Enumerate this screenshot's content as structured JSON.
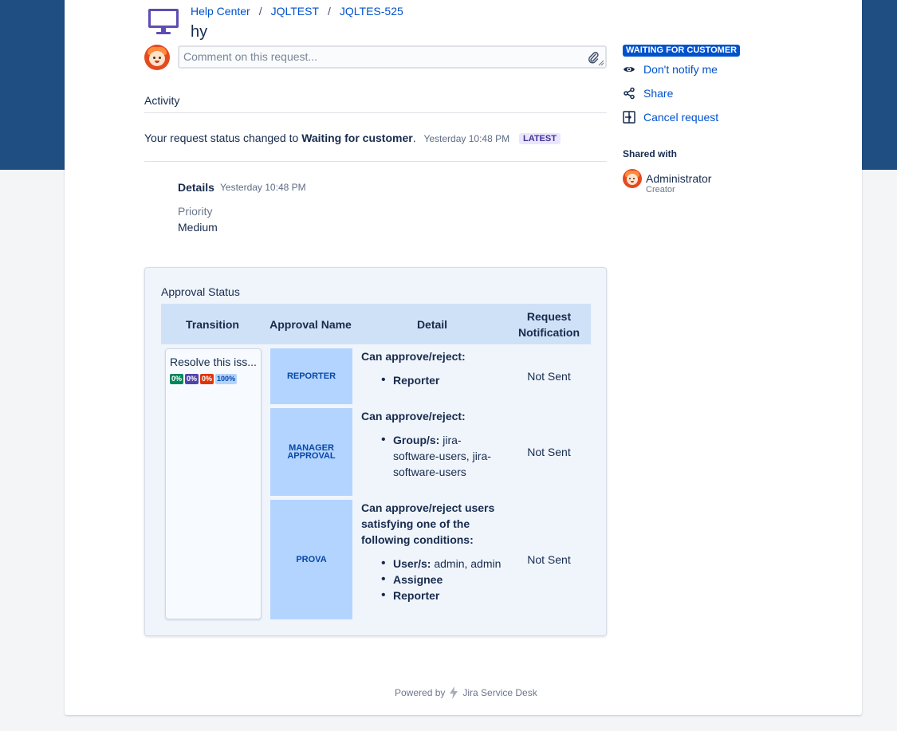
{
  "breadcrumb": [
    "Help Center",
    "JQLTEST",
    "JQLTES-525"
  ],
  "request": {
    "title": "hy"
  },
  "comment": {
    "placeholder": "Comment on this request..."
  },
  "activity": {
    "heading": "Activity",
    "status_prefix": "Your request status changed to",
    "status_value": "Waiting for customer",
    "status_suffix": ".",
    "status_time": "Yesterday 10:48 PM",
    "latest_badge": "LATEST",
    "details_label": "Details",
    "details_time": "Yesterday 10:48 PM",
    "priority_label": "Priority",
    "priority_value": "Medium"
  },
  "approval": {
    "title": "Approval Status",
    "columns": [
      "Transition",
      "Approval Name",
      "Detail",
      "Request Notification"
    ],
    "transition": {
      "name": "Resolve this iss...",
      "percentages": [
        "0%",
        "0%",
        "0%",
        "100%"
      ]
    },
    "rows": [
      {
        "name": "REPORTER",
        "detail_heading": "Can approve/reject:",
        "items": [
          {
            "label": "Reporter",
            "value": ""
          }
        ],
        "notification": "Not Sent"
      },
      {
        "name": "MANAGER APPROVAL",
        "detail_heading": "Can approve/reject:",
        "items": [
          {
            "label": "Group/s:",
            "value": "jira-software-users, jira-software-users"
          }
        ],
        "notification": "Not Sent"
      },
      {
        "name": "PROVA",
        "detail_heading": "Can approve/reject users satisfying one of the following conditions:",
        "items": [
          {
            "label": "User/s:",
            "value": "admin, admin"
          },
          {
            "label": "Assignee",
            "value": ""
          },
          {
            "label": "Reporter",
            "value": ""
          }
        ],
        "notification": "Not Sent"
      }
    ]
  },
  "footer": {
    "powered_by": "Powered by",
    "product": "Jira Service Desk"
  },
  "sidebar": {
    "status": "WAITING FOR CUSTOMER",
    "actions": [
      "Don't notify me",
      "Share",
      "Cancel request"
    ],
    "shared_with_label": "Shared with",
    "shared_user": {
      "name": "Administrator",
      "role": "Creator"
    }
  },
  "colors": {
    "banner": "#1f4e82",
    "link": "#0052cc",
    "status_lozenge": "#0052cc",
    "approval_block": "#b3d4ff",
    "latest_badge_bg": "#eae6ff"
  },
  "icons": [
    "monitor-icon",
    "paperclip-icon",
    "eye-icon",
    "share-icon",
    "cancel-request-icon",
    "jira-bolt-icon"
  ]
}
